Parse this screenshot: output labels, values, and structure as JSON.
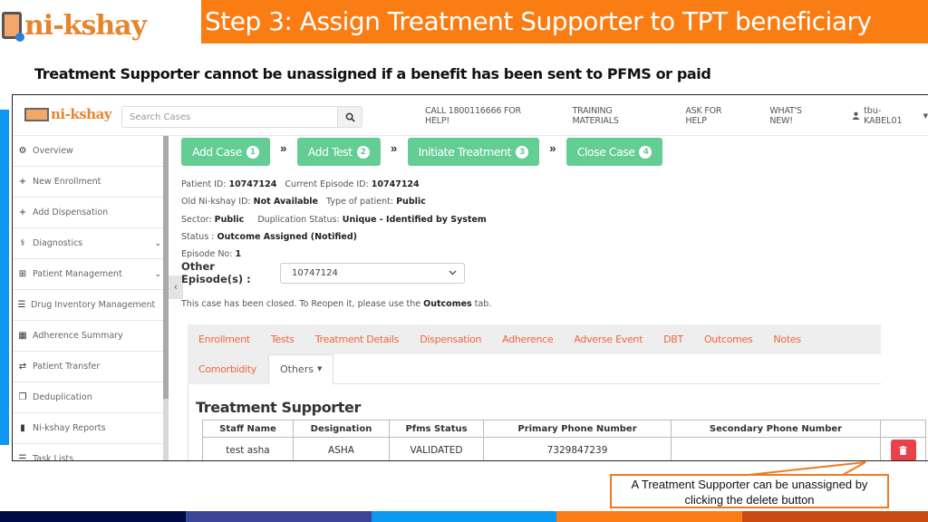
{
  "slide": {
    "logo_text": "ni-kshay",
    "title": "Step 3: Assign Treatment Supporter to TPT beneficiary",
    "subtitle": "Treatment Supporter cannot be unassigned if a benefit has been sent to PFMS or paid",
    "callout": "A Treatment Supporter can be  unassigned by clicking the  delete button",
    "footer_colors": [
      "#000b45",
      "#3a4596",
      "#0a98f2",
      "#fb7b14",
      "#c94a14"
    ]
  },
  "app": {
    "logo_text": "ni-kshay",
    "search": {
      "placeholder": "Search Cases",
      "icon": "search-icon"
    },
    "nav": {
      "links": [
        "CALL 1800116666 FOR HELP!",
        "TRAINING MATERIALS",
        "ASK FOR HELP",
        "WHAT'S NEW!"
      ],
      "user": "tbu-KABEL01"
    },
    "sidebar": {
      "items": [
        {
          "label": "Overview",
          "icon": "dashboard-icon",
          "glyph": "⚙",
          "expandable": false
        },
        {
          "label": "New Enrollment",
          "icon": "plus-icon",
          "glyph": "+",
          "expandable": false
        },
        {
          "label": "Add Dispensation",
          "icon": "plus-icon",
          "glyph": "+",
          "expandable": false
        },
        {
          "label": "Diagnostics",
          "icon": "stethoscope-icon",
          "glyph": "⚕",
          "expandable": true
        },
        {
          "label": "Patient Management",
          "icon": "medkit-icon",
          "glyph": "⊞",
          "expandable": true
        },
        {
          "label": "Drug Inventory Management",
          "icon": "list-icon",
          "glyph": "☰",
          "expandable": false
        },
        {
          "label": "Adherence Summary",
          "icon": "calendar-icon",
          "glyph": "▦",
          "expandable": false
        },
        {
          "label": "Patient Transfer",
          "icon": "transfer-icon",
          "glyph": "⇄",
          "expandable": false
        },
        {
          "label": "Deduplication",
          "icon": "copy-icon",
          "glyph": "❐",
          "expandable": false
        },
        {
          "label": "Ni-kshay Reports",
          "icon": "file-icon",
          "glyph": "▮",
          "expandable": false
        },
        {
          "label": "Task Lists",
          "icon": "list-icon",
          "glyph": "☰",
          "expandable": false
        }
      ]
    },
    "workflow": {
      "steps": [
        {
          "label": "Add Case",
          "num": "1"
        },
        {
          "label": "Add Test",
          "num": "2"
        },
        {
          "label": "Initiate Treatment",
          "num": "3"
        },
        {
          "label": "Close Case",
          "num": "4"
        }
      ],
      "separator": "»"
    },
    "patient": {
      "patient_id_label": "Patient ID:",
      "patient_id": "10747124",
      "episode_id_label": "Current Episode ID:",
      "episode_id": "10747124",
      "old_id_label": "Old Ni-kshay ID:",
      "old_id": "Not Available",
      "type_label": "Type of patient:",
      "type": "Public",
      "sector_label": "Sector:",
      "sector": "Public",
      "dup_label": "Duplication Status:",
      "dup": "Unique - Identified by System",
      "status_label": "Status :",
      "status": "Outcome Assigned (Notified)",
      "episode_no_label": "Episode No:",
      "episode_no": "1",
      "other_episodes_label": "Other Episode(s) :",
      "other_episodes_value": "10747124"
    },
    "closed_msg": {
      "before": "This case has been closed. To Reopen it, please use the ",
      "bold": "Outcomes",
      "after": " tab."
    },
    "tabs": {
      "row1": [
        "Enrollment",
        "Tests",
        "Treatment Details",
        "Dispensation",
        "Adherence",
        "Adverse Event",
        "DBT",
        "Outcomes",
        "Notes"
      ],
      "row2": [
        "Comorbidity"
      ],
      "active": "Others"
    },
    "treatment_supporter": {
      "title": "Treatment Supporter",
      "columns": [
        "Staff Name",
        "Designation",
        "Pfms Status",
        "Primary Phone Number",
        "Secondary Phone Number",
        ""
      ],
      "rows": [
        [
          "test asha",
          "ASHA",
          "VALIDATED",
          "7329847239",
          ""
        ]
      ],
      "delete_icon": "trash-icon"
    }
  }
}
